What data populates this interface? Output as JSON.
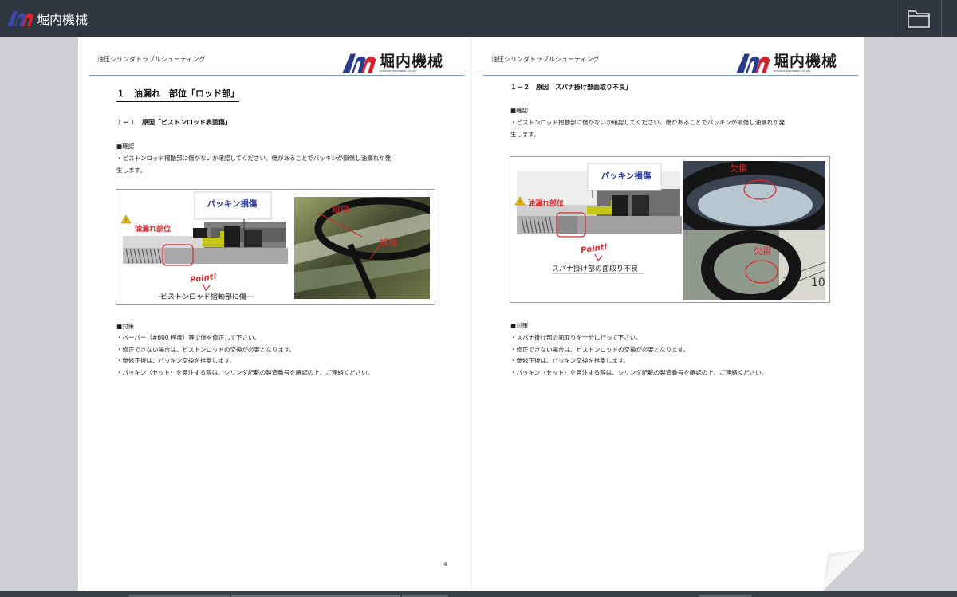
{
  "topbar": {
    "brand": "堀内機械",
    "folder_icon": "folder-icon"
  },
  "left_page": {
    "header_title": "油圧シリンダトラブルシューティング",
    "logo_text": "堀内機械",
    "logo_sub": "HORIUCHI MACHINERY CO.,LTD.",
    "section_title": "１　油漏れ　部位「ロッド部」",
    "sub_title": "１－１　原因「ピストンロッド表面傷」",
    "check_heading": "■確認",
    "check_text_1": "・ピストンロッド摺動部に傷がないか確認してください。傷があることでパッキンが損傷し油漏れが発",
    "check_text_2": "生します。",
    "figure": {
      "callout": "パッキン損傷",
      "leak_label": "油漏れ部位",
      "point_label": "Point!",
      "caption": "ピストンロッド摺動部に傷",
      "photo_label_1": "縦傷",
      "photo_label_2": "横傷"
    },
    "measures_heading": "■対策",
    "measures": [
      "・ペーパー（#600 程度）等で傷を修正して下さい。",
      "・修正できない場合は、ピストンロッドの交換が必要となります。",
      "・傷修正後は、パッキン交換を推奨します。",
      "・パッキン（セット）を発注する際は、シリンダ記載の製造番号を確認の上、ご連絡ください。"
    ],
    "page_number": "4"
  },
  "right_page": {
    "header_title": "油圧シリンダトラブルシューティング",
    "logo_text": "堀内機械",
    "logo_sub": "HORIUCHI MACHINERY CO.,LTD.",
    "sub_title": "１－２　原因「スパナ掛け部面取り不良」",
    "check_heading": "■確認",
    "check_text_1": "・ピストンロッド摺動部に傷がないか確認してください。傷があることでパッキンが損傷し油漏れが発",
    "check_text_2": "生します。",
    "figure": {
      "callout": "パッキン損傷",
      "leak_label": "油漏れ部位",
      "point_label": "Point!",
      "caption": "スパナ掛け部の面取り不良",
      "photo_label_1": "欠損",
      "photo_label_2": "欠損"
    },
    "measures_heading": "■対策",
    "measures": [
      "・スパナ掛け部の面取りを十分に行って下さい。",
      "・修正できない場合は、ピストンロッドの交換が必要となります。",
      "・傷修正後は、パッキン交換を推奨します。",
      "・パッキン（セット）を発注する際は、シリンダ記載の製造番号を確認の上、ご連絡ください。"
    ]
  },
  "colors": {
    "topbar": "#2f3640",
    "logo_blue": "#2a3a8c",
    "logo_red": "#d4202a",
    "header_rule": "#7a9cc6",
    "callout_text": "#2a3aa0",
    "red_annotation": "#d8282a"
  }
}
